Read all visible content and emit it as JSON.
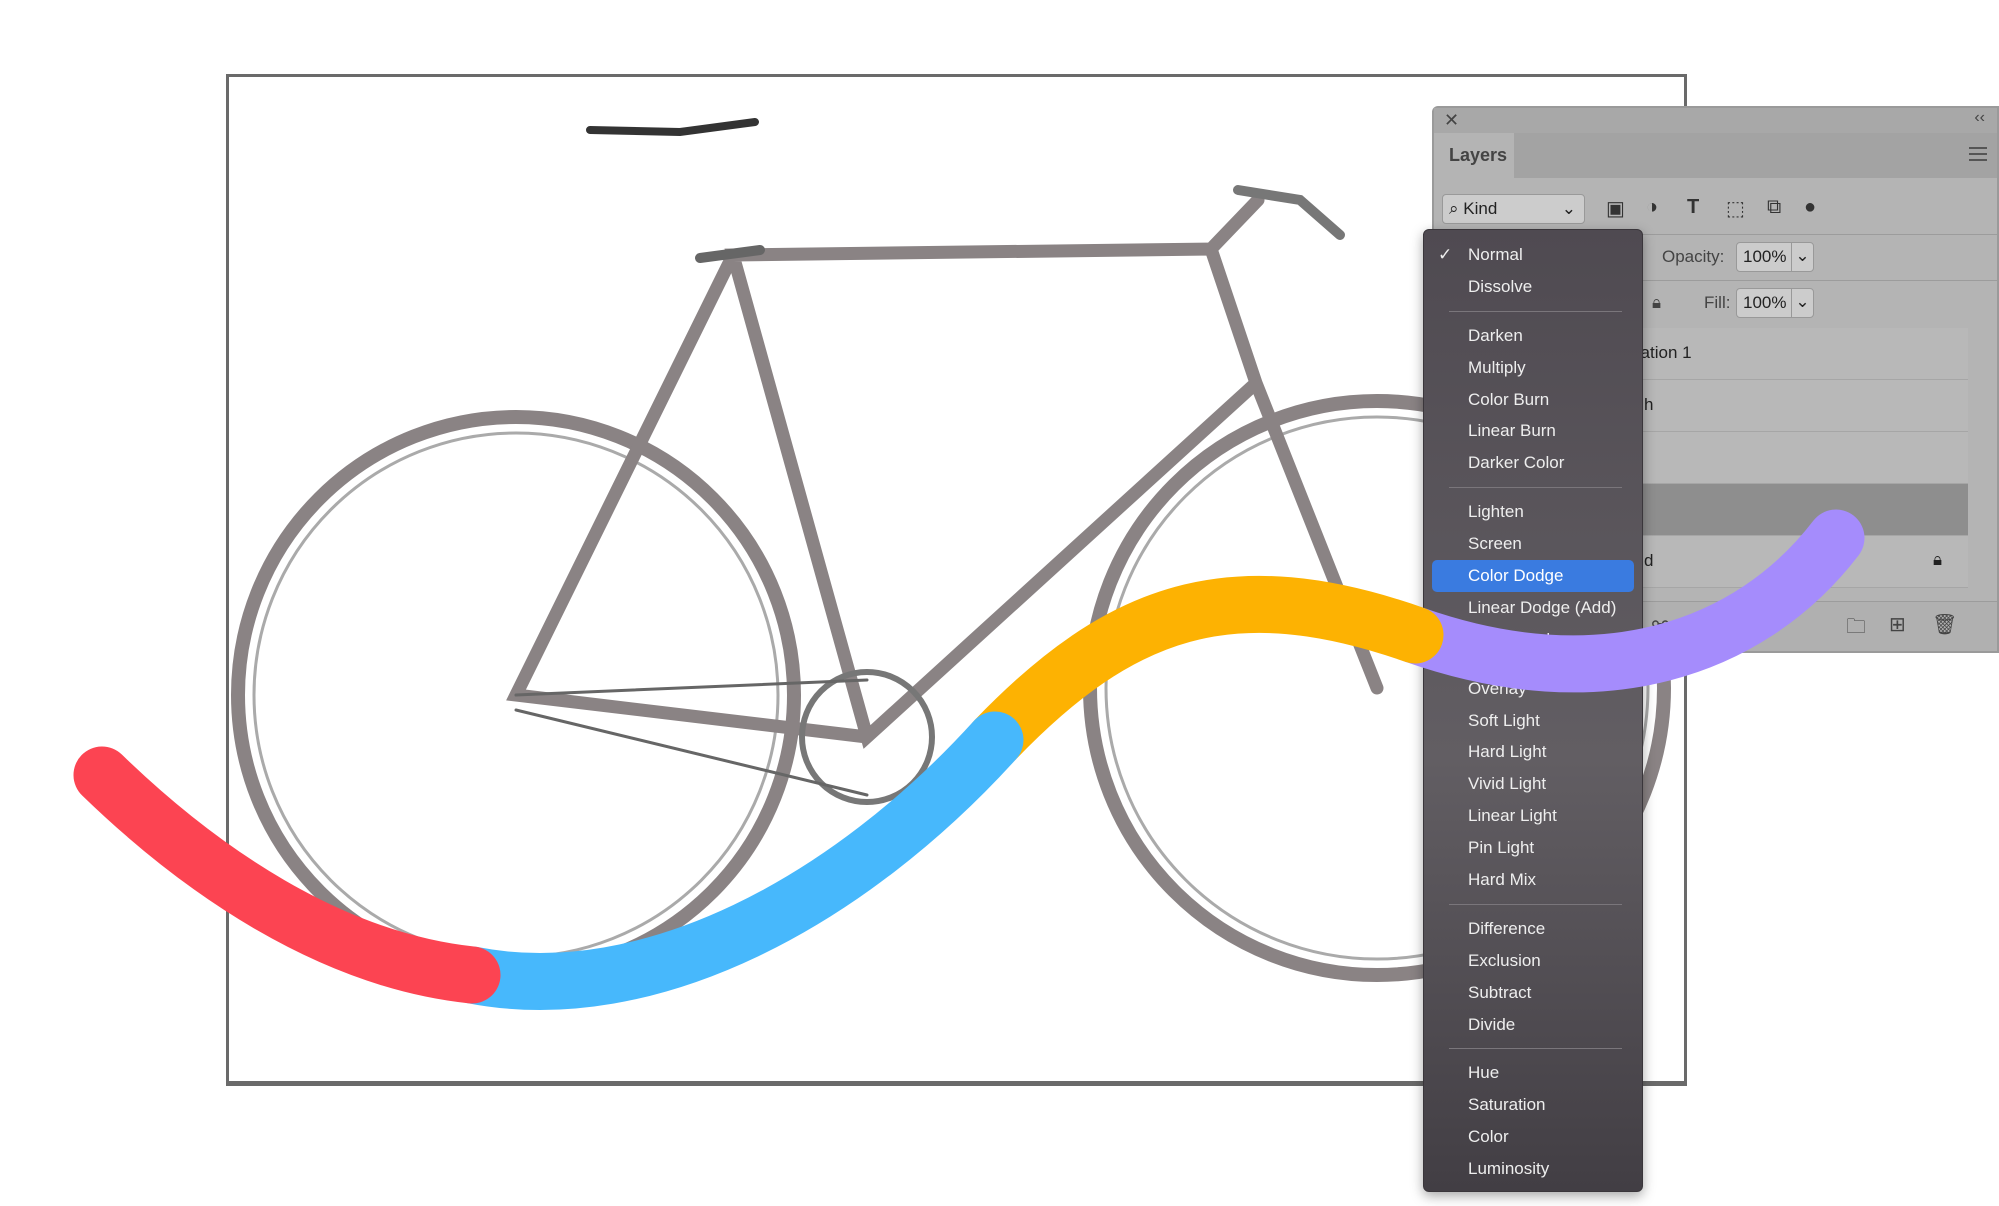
{
  "panel": {
    "close_icon": "close-icon",
    "collapse_label": "‹‹",
    "tab": "Layers",
    "filter": "Kind",
    "opacity_label": "Opacity:",
    "opacity_value": "100%",
    "fill_label": "Fill:",
    "fill_value": "100%",
    "layers": [
      "Hue/Saturation 1",
      "h",
      "",
      "",
      "d"
    ]
  },
  "blend_menu": {
    "selected": "Color Dodge",
    "groups": [
      [
        "Normal",
        "Dissolve"
      ],
      [
        "Darken",
        "Multiply",
        "Color Burn",
        "Linear Burn",
        "Darker Color"
      ],
      [
        "Lighten",
        "Screen",
        "Color Dodge",
        "Linear Dodge (Add)",
        "Lighter Color"
      ],
      [
        "Overlay",
        "Soft Light",
        "Hard Light",
        "Vivid Light",
        "Linear Light",
        "Pin Light",
        "Hard Mix"
      ],
      [
        "Difference",
        "Exclusion",
        "Subtract",
        "Divide"
      ],
      [
        "Hue",
        "Saturation",
        "Color",
        "Luminosity"
      ]
    ],
    "checked": "Normal"
  },
  "colors": {
    "red": "#fc4452",
    "blue": "#47b8fc",
    "orange": "#fdb202",
    "purple": "#a58cfc",
    "highlight": "#3a7be0"
  }
}
